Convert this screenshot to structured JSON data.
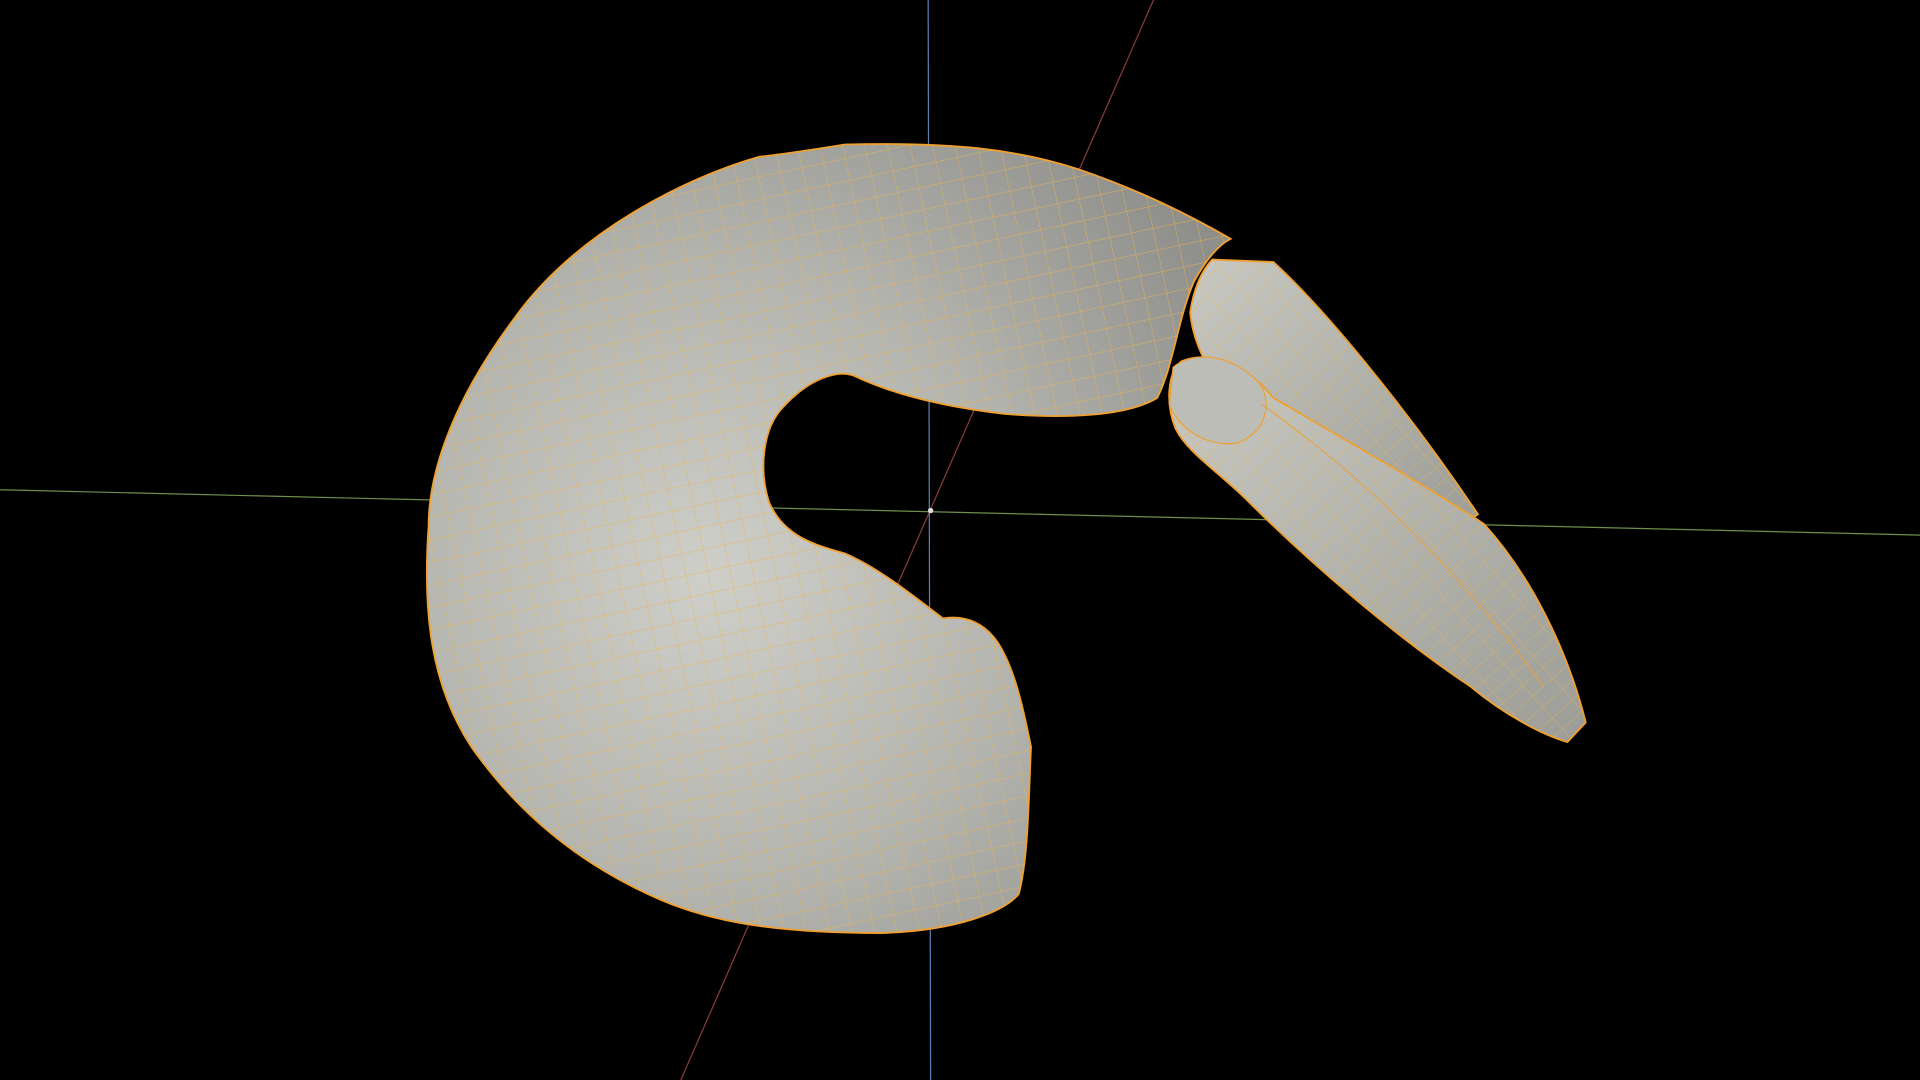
{
  "viewport": {
    "background_color": "#000000",
    "axes": {
      "x_axis_color": "#8a3a3a",
      "y_axis_color": "#6f8f4a",
      "z_axis_color": "#5a7fb5"
    },
    "mesh": {
      "name_icon": "mesh-object",
      "surface_color": "#b9b9b4",
      "wireframe_color": "#e8b64a",
      "outline_color": "#f0a030",
      "selected": true
    }
  }
}
